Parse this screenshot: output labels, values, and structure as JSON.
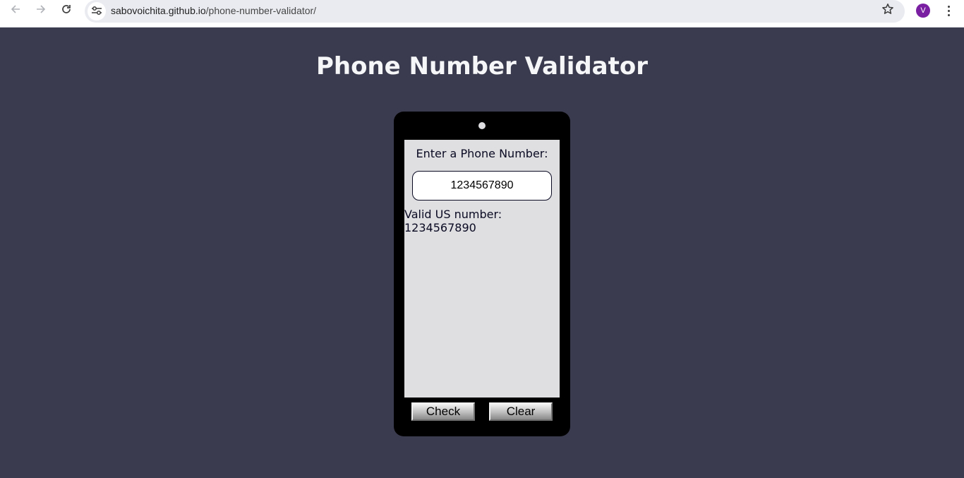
{
  "browser": {
    "url_host": "sabovoichita.github.io",
    "url_path": "/phone-number-validator/",
    "profile_initial": "V",
    "icons": {
      "back": "arrow-left-icon",
      "forward": "arrow-right-icon",
      "reload": "reload-icon",
      "site_info": "tune-icon",
      "bookmark": "star-icon",
      "menu": "kebab-menu-icon"
    },
    "colors": {
      "avatar": "#7b1fa2",
      "omnibox": "#e9ebf1"
    }
  },
  "page": {
    "title": "Phone Number Validator",
    "background": "#3b3b4f"
  },
  "phone": {
    "prompt_label": "Enter a Phone Number:",
    "input_value": "1234567890",
    "result_text": "Valid US number: 1234567890",
    "check_button": "Check",
    "clear_button": "Clear",
    "colors": {
      "frame": "#000000",
      "screen": "#dfdfe2",
      "text": "#0a0a23"
    }
  }
}
